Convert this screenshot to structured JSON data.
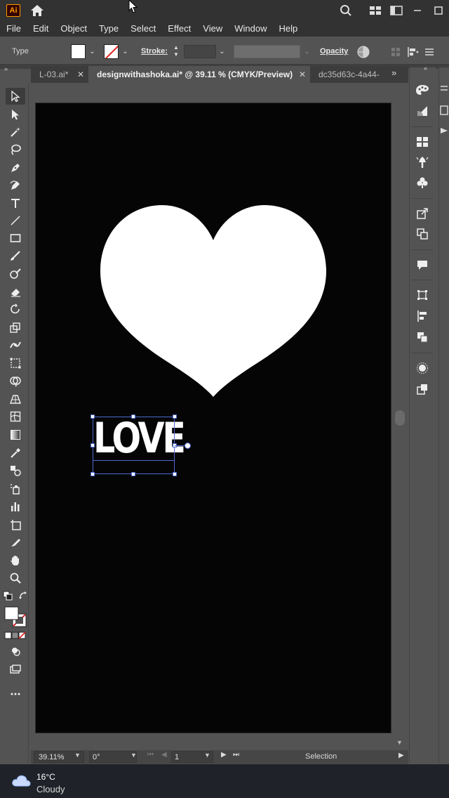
{
  "app": {
    "logo_text": "Ai"
  },
  "menu": [
    "File",
    "Edit",
    "Object",
    "Type",
    "Select",
    "Effect",
    "View",
    "Window",
    "Help"
  ],
  "control_bar": {
    "selection_type": "Type",
    "stroke_label": "Stroke:",
    "opacity_label": "Opacity"
  },
  "tabs": [
    {
      "label": "L-03.ai*",
      "active": false
    },
    {
      "label": "designwithashoka.ai* @ 39.11 % (CMYK/Preview)",
      "active": true
    },
    {
      "label": "dc35d63c-4a44-",
      "active": false
    }
  ],
  "tab_close_glyph": "✕",
  "canvas": {
    "artboard_color": "#050505",
    "heart_color": "#ffffff",
    "text_content": "LOVE",
    "selection_color": "#4d6bd1"
  },
  "status_bar": {
    "zoom": "39.11%",
    "rotation": "0°",
    "artboard_number": "1",
    "current_tool": "Selection"
  },
  "taskbar": {
    "temperature": "16°C",
    "condition": "Cloudy"
  }
}
